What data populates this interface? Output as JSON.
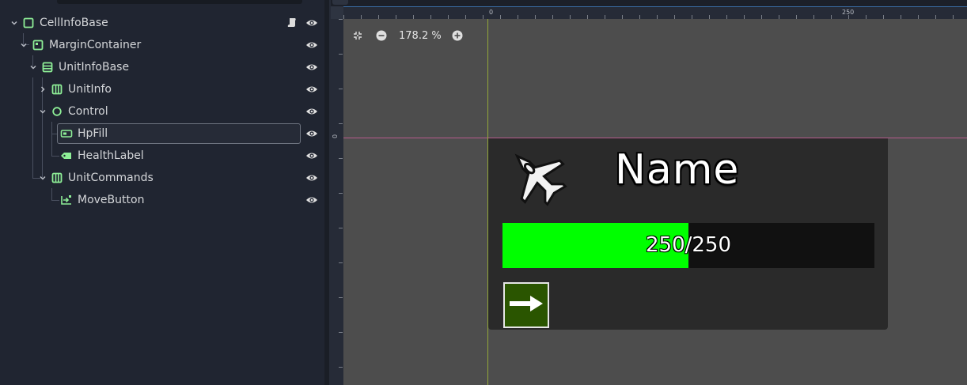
{
  "scene_tree": {
    "nodes": [
      {
        "label": "CellInfoBase",
        "icon": "control-node-icon",
        "has_script": true
      },
      {
        "label": "MarginContainer",
        "icon": "margin-container-icon"
      },
      {
        "label": "UnitInfoBase",
        "icon": "vbox-container-icon"
      },
      {
        "label": "UnitInfo",
        "icon": "hbox-container-icon",
        "collapsed": true
      },
      {
        "label": "Control",
        "icon": "control-circle-icon"
      },
      {
        "label": "HpFill",
        "icon": "progress-bar-icon",
        "selected": true
      },
      {
        "label": "HealthLabel",
        "icon": "label-icon"
      },
      {
        "label": "UnitCommands",
        "icon": "hbox-container-icon"
      },
      {
        "label": "MoveButton",
        "icon": "texture-button-icon"
      }
    ]
  },
  "toolbar": {
    "zoom_label": "178.2 %"
  },
  "rulers": {
    "h_labels": [
      "0",
      "250"
    ],
    "v_label": "0"
  },
  "scene": {
    "unit_name": "Name",
    "unit_icon": "fighter-jet-icon",
    "health_text": "250/250",
    "health_fraction": 0.5,
    "move_button_icon": "arrow-right-icon"
  },
  "colors": {
    "accent_icon_green": "#8eef97",
    "hp_fill": "#00ff00",
    "button_bg": "#2a5500",
    "axis_x": "#b55a8c",
    "axis_y": "#94a83a"
  }
}
